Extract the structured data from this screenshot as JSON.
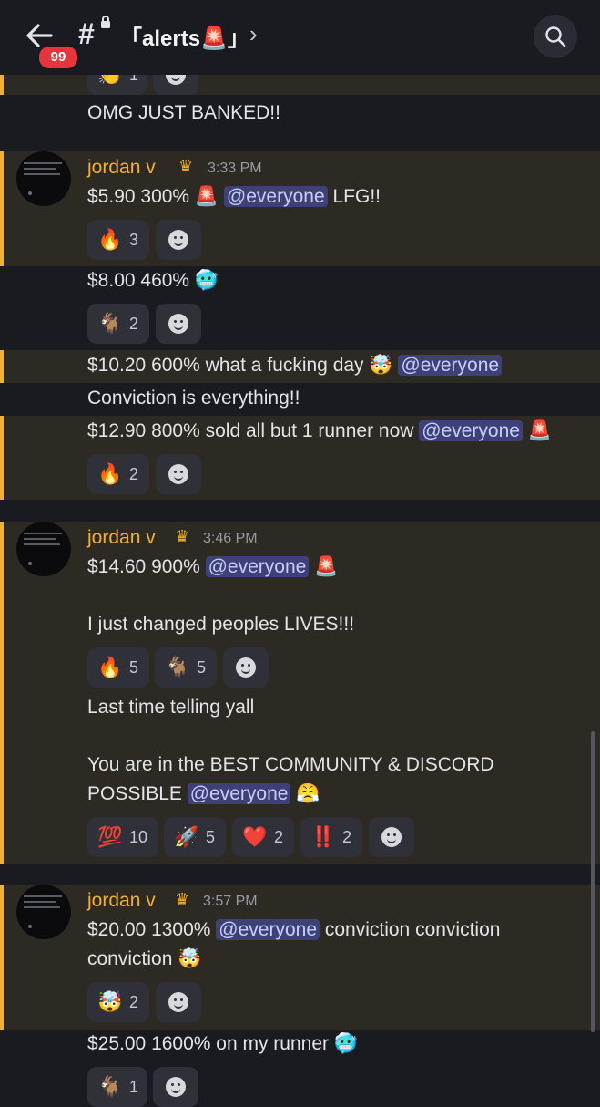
{
  "header": {
    "unread_count": "99",
    "channel_hash": "#",
    "channel_name": "「alerts🚨」",
    "chevron": "›",
    "icons": [
      "back-arrow-icon",
      "lock-icon",
      "search-icon"
    ]
  },
  "top_partial": {
    "reactions": [
      {
        "emoji": "👏",
        "count": "1"
      }
    ],
    "message": "OMG JUST BANKED!!"
  },
  "groups": [
    {
      "username": "jordan v",
      "crown": "♛",
      "time": "3:33 PM",
      "line1": {
        "prefix": "$5.90 300% 🚨 ",
        "mention": "@everyone",
        "suffix": " LFG!!"
      },
      "reactions1": [
        {
          "emoji": "🔥",
          "count": "3"
        }
      ],
      "line2": "$8.00 460% 🥶",
      "reactions2": [
        {
          "emoji": "🐐",
          "count": "2"
        }
      ],
      "line3": {
        "prefix": "$10.20 600% what a fucking day 🤯 ",
        "mention": "@everyone",
        "suffix": ""
      },
      "line4": "Conviction is everything!!",
      "line5": {
        "prefix": "$12.90 800% sold all but 1 runner now ",
        "mention": "@everyone",
        "suffix": " 🚨"
      },
      "reactions5": [
        {
          "emoji": "🔥",
          "count": "2"
        }
      ]
    },
    {
      "username": "jordan v",
      "crown": "♛",
      "time": "3:46 PM",
      "line1": {
        "prefix": "$14.60 900% ",
        "mention": "@everyone",
        "suffix": " 🚨"
      },
      "line2": "I just changed peoples LIVES!!!",
      "reactions1": [
        {
          "emoji": "🔥",
          "count": "5"
        },
        {
          "emoji": "🐐",
          "count": "5"
        }
      ],
      "line3": "Last time telling yall",
      "line4a": "You are in the BEST COMMUNITY & DISCORD",
      "line4b": {
        "prefix": "POSSIBLE ",
        "mention": "@everyone",
        "suffix": " 😤"
      },
      "reactions2": [
        {
          "emoji": "💯",
          "count": "10"
        },
        {
          "emoji": "🚀",
          "count": "5"
        },
        {
          "emoji": "❤️",
          "count": "2"
        },
        {
          "emoji": "‼️",
          "count": "2"
        }
      ]
    },
    {
      "username": "jordan v",
      "crown": "♛",
      "time": "3:57 PM",
      "line1": {
        "prefix": "$20.00 1300% ",
        "mention": "@everyone",
        "suffix": " conviction conviction"
      },
      "line1b": "conviction 🤯",
      "reactions1": [
        {
          "emoji": "🤯",
          "count": "2"
        }
      ],
      "line2": "$25.00 1600% on my runner 🥶",
      "reactions2": [
        {
          "emoji": "🐐",
          "count": "1"
        }
      ]
    }
  ],
  "colors": {
    "accent_gold": "#f0b132",
    "mention_bg": "#3d4178",
    "badge_red": "#e5353d",
    "highlight_bg": "#2c2a23"
  }
}
